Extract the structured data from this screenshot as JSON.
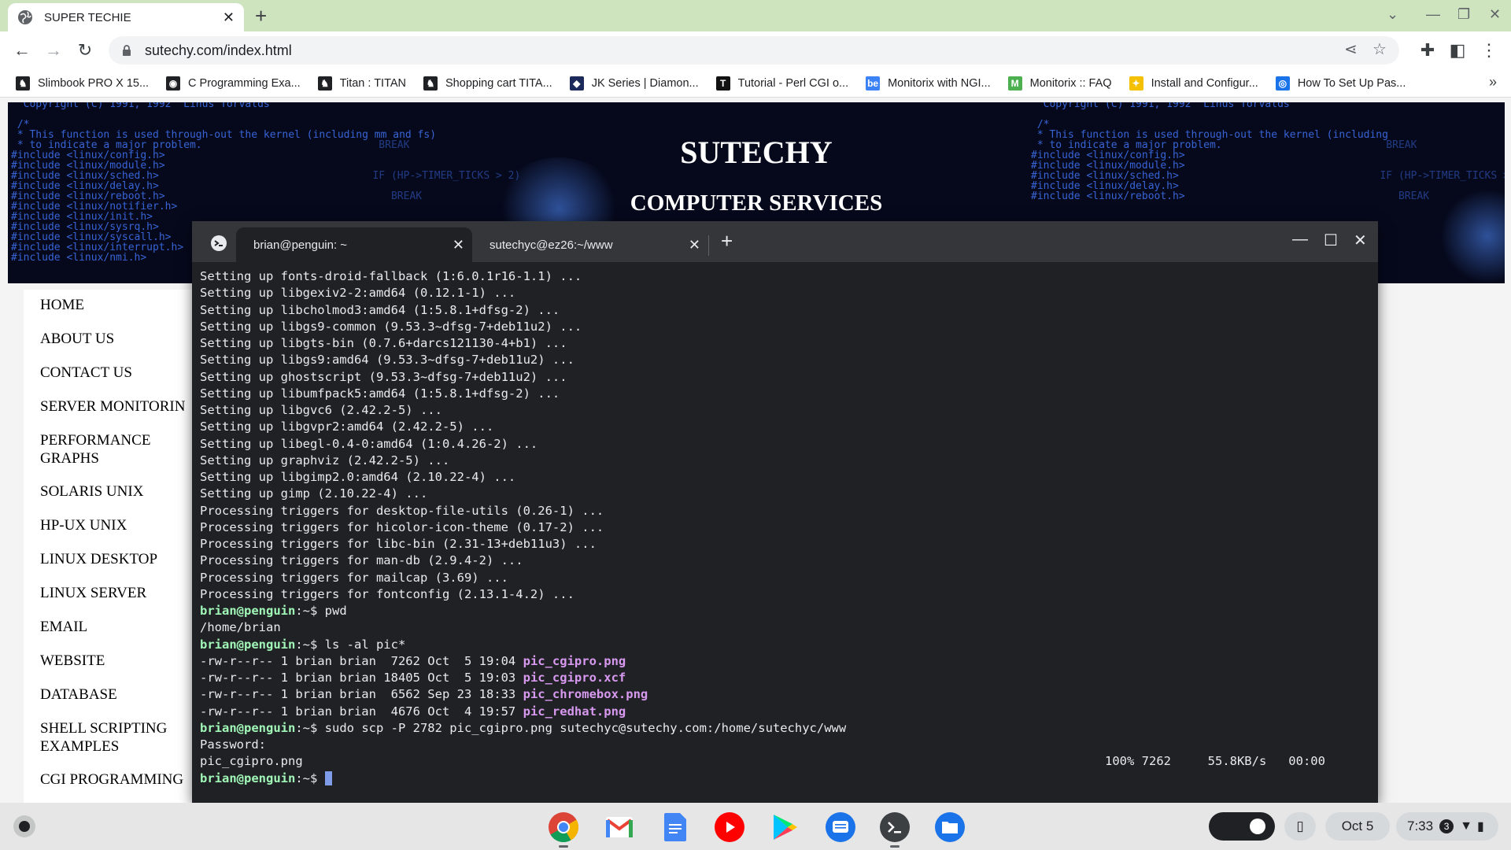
{
  "browser": {
    "tab_title": "SUPER TECHIE",
    "url": "sutechy.com/index.html",
    "bookmarks": [
      {
        "label": "Slimbook PRO X 15...",
        "icon": "horse-icon"
      },
      {
        "label": "C Programming Exa...",
        "icon": "globe-icon"
      },
      {
        "label": "Titan : TITAN",
        "icon": "horse-icon"
      },
      {
        "label": "Shopping cart TITA...",
        "icon": "horse-icon"
      },
      {
        "label": "JK Series | Diamon...",
        "icon": "diamond-icon"
      },
      {
        "label": "Tutorial - Perl CGI o...",
        "icon": "t-icon"
      },
      {
        "label": "Monitorix with NGI...",
        "icon": "be-icon"
      },
      {
        "label": "Monitorix :: FAQ",
        "icon": "m-icon"
      },
      {
        "label": "Install and Configur...",
        "icon": "bulb-icon"
      },
      {
        "label": "How To Set Up Pas...",
        "icon": "do-icon"
      }
    ]
  },
  "site": {
    "title": "SUTECHY",
    "subtitle": "COMPUTER SERVICES",
    "nav": [
      [
        "HOME"
      ],
      [
        "ABOUT US"
      ],
      [
        "CONTACT US"
      ],
      [
        "SERVER MONITORIN"
      ],
      [
        "PERFORMANCE",
        "GRAPHS"
      ],
      [
        "SOLARIS UNIX"
      ],
      [
        "HP-UX UNIX"
      ],
      [
        "LINUX DESKTOP"
      ],
      [
        "LINUX SERVER"
      ],
      [
        "EMAIL"
      ],
      [
        "WEBSITE"
      ],
      [
        "DATABASE"
      ],
      [
        "SHELL SCRIPTING",
        "EXAMPLES"
      ],
      [
        "CGI PROGRAMMING"
      ]
    ],
    "banner_code_left": "  Copyright (C) 1991, 1992  Linus Torvalds\n\n /*\n * This function is used through-out the kernel (including mm and fs)\n * to indicate a major problem.\n#include <linux/config.h>\n#include <linux/module.h>\n#include <linux/sched.h>\n#include <linux/delay.h>\n#include <linux/reboot.h>\n#include <linux/notifier.h>\n#include <linux/init.h>\n#include <linux/sysrq.h>\n#include <linux/syscall.h>\n#include <linux/interrupt.h>\n#include <linux/nmi.h>",
    "banner_code_right": "  Copyright (C) 1991, 1992  Linus Torvalds\n\n /*\n * This function is used through-out the kernel (including\n * to indicate a major problem.\n#include <linux/config.h>\n#include <linux/module.h>\n#include <linux/sched.h>\n#include <linux/delay.h>\n#include <linux/reboot.h>",
    "banner_code_mid": "    BREAK\n\n\n   IF (HP->TIMER_TICKS > 2)\n\n      BREAK"
  },
  "terminal": {
    "tabs": [
      {
        "label": "brian@penguin: ~",
        "active": true
      },
      {
        "label": "sutechyc@ez26:~/www",
        "active": false
      }
    ],
    "lines": [
      {
        "t": "Setting up fonts-droid-fallback (1:6.0.1r16-1.1) ..."
      },
      {
        "t": "Setting up libgexiv2-2:amd64 (0.12.1-1) ..."
      },
      {
        "t": "Setting up libcholmod3:amd64 (1:5.8.1+dfsg-2) ..."
      },
      {
        "t": "Setting up libgs9-common (9.53.3~dfsg-7+deb11u2) ..."
      },
      {
        "t": "Setting up libgts-bin (0.7.6+darcs121130-4+b1) ..."
      },
      {
        "t": "Setting up libgs9:amd64 (9.53.3~dfsg-7+deb11u2) ..."
      },
      {
        "t": "Setting up ghostscript (9.53.3~dfsg-7+deb11u2) ..."
      },
      {
        "t": "Setting up libumfpack5:amd64 (1:5.8.1+dfsg-2) ..."
      },
      {
        "t": "Setting up libgvc6 (2.42.2-5) ..."
      },
      {
        "t": "Setting up libgvpr2:amd64 (2.42.2-5) ..."
      },
      {
        "t": "Setting up libegl-0.4-0:amd64 (1:0.4.26-2) ..."
      },
      {
        "t": "Setting up graphviz (2.42.2-5) ..."
      },
      {
        "t": "Setting up libgimp2.0:amd64 (2.10.22-4) ..."
      },
      {
        "t": "Setting up gimp (2.10.22-4) ..."
      },
      {
        "t": "Processing triggers for desktop-file-utils (0.26-1) ..."
      },
      {
        "t": "Processing triggers for hicolor-icon-theme (0.17-2) ..."
      },
      {
        "t": "Processing triggers for libc-bin (2.31-13+deb11u3) ..."
      },
      {
        "t": "Processing triggers for man-db (2.9.4-2) ..."
      },
      {
        "t": "Processing triggers for mailcap (3.69) ..."
      },
      {
        "t": "Processing triggers for fontconfig (2.13.1-4.2) ..."
      },
      {
        "p": "brian@penguin",
        "c": ":~$ pwd"
      },
      {
        "t": "/home/brian"
      },
      {
        "p": "brian@penguin",
        "c": ":~$ ls -al pic*"
      },
      {
        "t": "-rw-r--r-- 1 brian brian  7262 Oct  5 19:04 ",
        "f": "pic_cgipro.png"
      },
      {
        "t": "-rw-r--r-- 1 brian brian 18405 Oct  5 19:03 ",
        "f": "pic_cgipro.xcf"
      },
      {
        "t": "-rw-r--r-- 1 brian brian  6562 Sep 23 18:33 ",
        "f": "pic_chromebox.png"
      },
      {
        "t": "-rw-r--r-- 1 brian brian  4676 Oct  4 19:57 ",
        "f": "pic_redhat.png"
      },
      {
        "p": "brian@penguin",
        "c": ":~$ sudo scp -P 2782 pic_cgipro.png sutechyc@sutechy.com:/home/sutechyc/www"
      },
      {
        "t": "Password:"
      },
      {
        "t": "pic_cgipro.png",
        "r": "100% 7262     55.8KB/s   00:00"
      },
      {
        "p": "brian@penguin",
        "c": ":~$ ",
        "cursor": true
      }
    ]
  },
  "shelf": {
    "apps": [
      "chrome-icon",
      "gmail-icon",
      "docs-icon",
      "youtube-icon",
      "play-store-icon",
      "messages-icon",
      "terminal-icon",
      "files-icon"
    ],
    "date": "Oct 5",
    "time": "7:33",
    "notification_count": "3"
  },
  "colors": {
    "tabstrip": "#cde4bf",
    "terminal_bg": "#202124",
    "prompt": "#a1f7b8",
    "filename": "#d799ef"
  }
}
